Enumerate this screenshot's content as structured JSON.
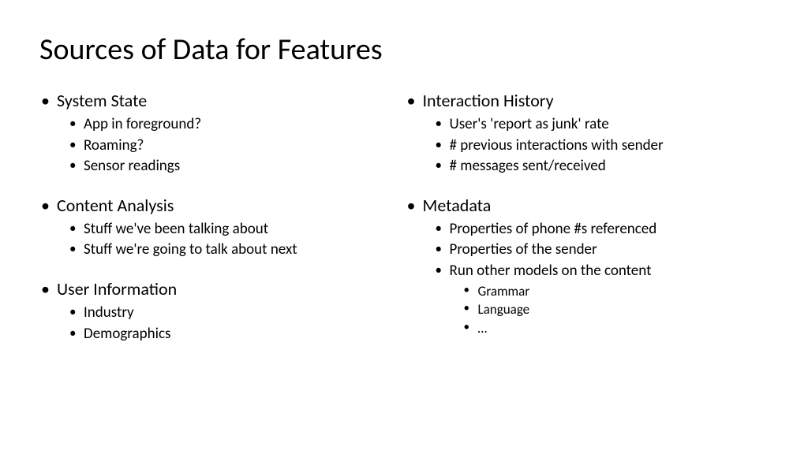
{
  "title": "Sources of Data for Features",
  "left": {
    "sections": [
      {
        "title": "System State",
        "items": [
          "App in foreground?",
          "Roaming?",
          "Sensor readings"
        ]
      },
      {
        "title": "Content Analysis",
        "items": [
          "Stuff we've been talking about",
          "Stuff we're going to talk about next"
        ]
      },
      {
        "title": "User Information",
        "items": [
          "Industry",
          "Demographics"
        ]
      }
    ]
  },
  "right": {
    "sections": [
      {
        "title": "Interaction History",
        "items": [
          "User's 'report as junk' rate",
          "# previous interactions with sender",
          "# messages sent/received"
        ]
      },
      {
        "title": "Metadata",
        "items": [
          "Properties of phone #s referenced",
          "Properties of the sender",
          "Run other models on the content"
        ],
        "subitems": [
          "Grammar",
          "Language",
          "…"
        ]
      }
    ]
  }
}
